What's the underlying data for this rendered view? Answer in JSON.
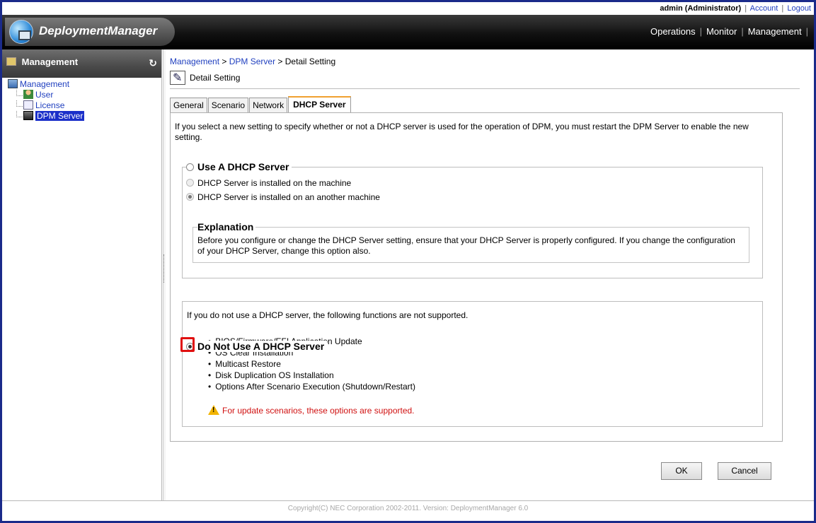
{
  "topbar": {
    "user": "admin (Administrator)",
    "account_link": "Account",
    "logout_link": "Logout",
    "separator": "|"
  },
  "header": {
    "logo_text": "DeploymentManager",
    "nav": [
      "Operations",
      "Monitor",
      "Management"
    ]
  },
  "sidebar": {
    "title": "Management",
    "tree": {
      "root": "Management",
      "items": [
        {
          "label": "User",
          "icon": "user-icon"
        },
        {
          "label": "License",
          "icon": "license-icon"
        },
        {
          "label": "DPM Server",
          "icon": "server-icon",
          "selected": true
        }
      ]
    }
  },
  "breadcrumb": {
    "items": [
      "Management",
      "DPM Server"
    ],
    "current": "Detail Setting",
    "sep": " > "
  },
  "page_title": "Detail Setting",
  "tabs": [
    {
      "label": "General",
      "active": false
    },
    {
      "label": "Scenario",
      "active": false
    },
    {
      "label": "Network",
      "active": false
    },
    {
      "label": "DHCP Server",
      "active": true
    }
  ],
  "dhcp": {
    "intro": "If you select a new setting to specify whether or not a DHCP server is used for the operation of DPM, you must restart the DPM Server to enable the new setting.",
    "use_option": {
      "label": "Use A DHCP Server",
      "checked": false,
      "sub_options": [
        {
          "label": "DHCP Server is installed on the machine",
          "checked": false
        },
        {
          "label": "DHCP Server is installed on an another machine",
          "checked": true
        }
      ],
      "explanation_title": "Explanation",
      "explanation_text": "Before you configure or change the DHCP Server setting, ensure that your DHCP Server is properly configured. If you change the configuration of your DHCP Server, change this option also."
    },
    "no_use_option": {
      "label": "Do Not Use A DHCP Server",
      "checked": true,
      "description": "If you do not use a DHCP server, the following functions are not supported.",
      "functions": [
        "BIOS/Firmware/EFI Application Update",
        "OS Clear Installation",
        "Multicast Restore",
        "Disk Duplication OS Installation",
        "Options After Scenario Execution (Shutdown/Restart)"
      ],
      "warning": "For update scenarios, these options are supported."
    }
  },
  "buttons": {
    "ok": "OK",
    "cancel": "Cancel"
  },
  "footer": "Copyright(C) NEC Corporation 2002-2011. Version: DeploymentManager 6.0",
  "colors": {
    "link": "#1f3fbf",
    "warning": "#d01010",
    "highlight": "#e01010",
    "selected": "#1a2fc9"
  }
}
